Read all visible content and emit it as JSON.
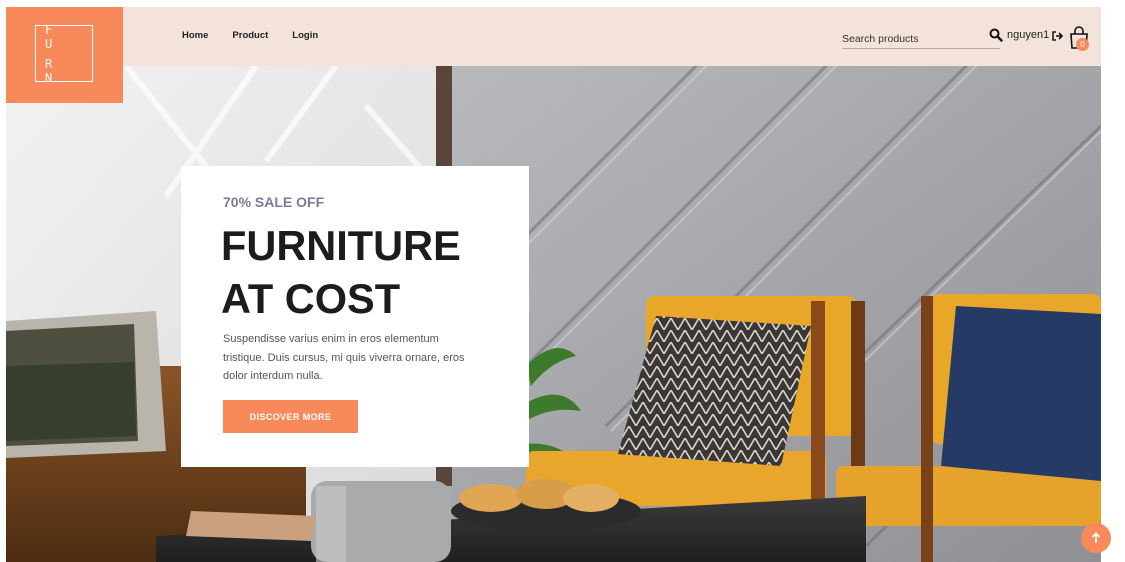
{
  "logo": {
    "line1": "F U",
    "line2": "R N"
  },
  "nav": {
    "items": [
      {
        "label": "Home"
      },
      {
        "label": "Product"
      },
      {
        "label": "Login"
      }
    ]
  },
  "search": {
    "placeholder": "Search products",
    "value": ""
  },
  "user": {
    "name": "nguyen1"
  },
  "cart": {
    "count": "0"
  },
  "hero": {
    "kicker": "70% SALE OFF",
    "headline_line1": "FURNITURE",
    "headline_line2": "AT COST",
    "body": "Suspendisse varius enim in eros elementum tristique. Duis cursus, mi quis viverra ornare, eros dolor interdum nulla.",
    "cta_label": "DISCOVER MORE"
  },
  "icons": {
    "search": "search-icon",
    "logout": "logout-icon",
    "cart": "shopping-bag-icon",
    "scroll_top": "arrow-up-icon"
  },
  "colors": {
    "accent": "#f7895b",
    "header_bg": "#f4e3da",
    "headline": "#1c1c1c",
    "kicker": "#7a7b96"
  }
}
